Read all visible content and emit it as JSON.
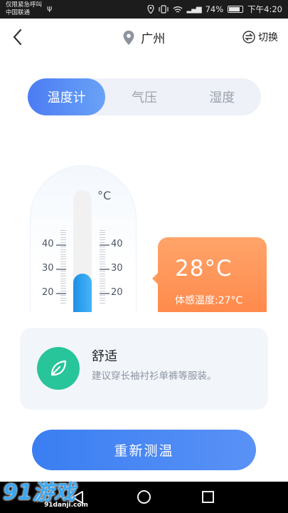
{
  "status_bar": {
    "carrier_line1": "仅限紧急呼叫",
    "carrier_line2": "中国联通",
    "battery": "74%",
    "time": "下午4:20"
  },
  "header": {
    "city": "广州",
    "switch_label": "切换"
  },
  "tabs": [
    "温度计",
    "气压",
    "湿度"
  ],
  "active_tab": 0,
  "thermometer": {
    "unit": "°C",
    "scale_labels": [
      "40",
      "30",
      "20"
    ],
    "level_celsius": 28
  },
  "reading": {
    "value": "28°C",
    "feels_like": "体感温度:27°C"
  },
  "advice": {
    "title": "舒适",
    "text": "建议穿长袖衬衫单裤等服装。"
  },
  "remeasure_label": "重新测温",
  "watermark": {
    "logo": "91游戏",
    "site": "91danji.com"
  },
  "colors": {
    "accent": "#4b7cf3",
    "reading_bubble": "#ff9b5e",
    "advice_icon": "#28c59b",
    "mercury": "#2a9bf0"
  }
}
